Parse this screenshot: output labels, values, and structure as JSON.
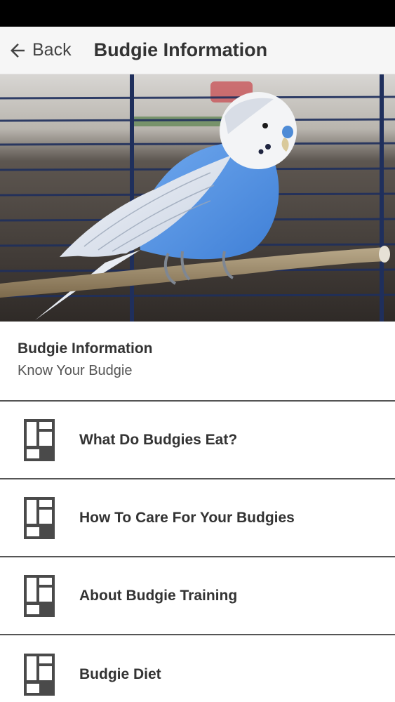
{
  "app_bar": {
    "back_label": "Back",
    "title": "Budgie Information",
    "back_icon": "arrow-left-icon"
  },
  "hero": {
    "image": "budgie-on-perch-photo"
  },
  "intro": {
    "title": "Budgie Information",
    "subtitle": "Know Your Budgie"
  },
  "list": {
    "icon": "article-layout-icon",
    "items": [
      {
        "label": "What Do Budgies Eat?"
      },
      {
        "label": "How To Care For Your Budgies"
      },
      {
        "label": "About Budgie Training"
      },
      {
        "label": "Budgie Diet"
      }
    ]
  },
  "colors": {
    "status_bar": "#000000",
    "app_bar": "#f6f6f6",
    "text": "#333333",
    "divider": "#555555",
    "budgie_blue": "#4f8fe0"
  }
}
